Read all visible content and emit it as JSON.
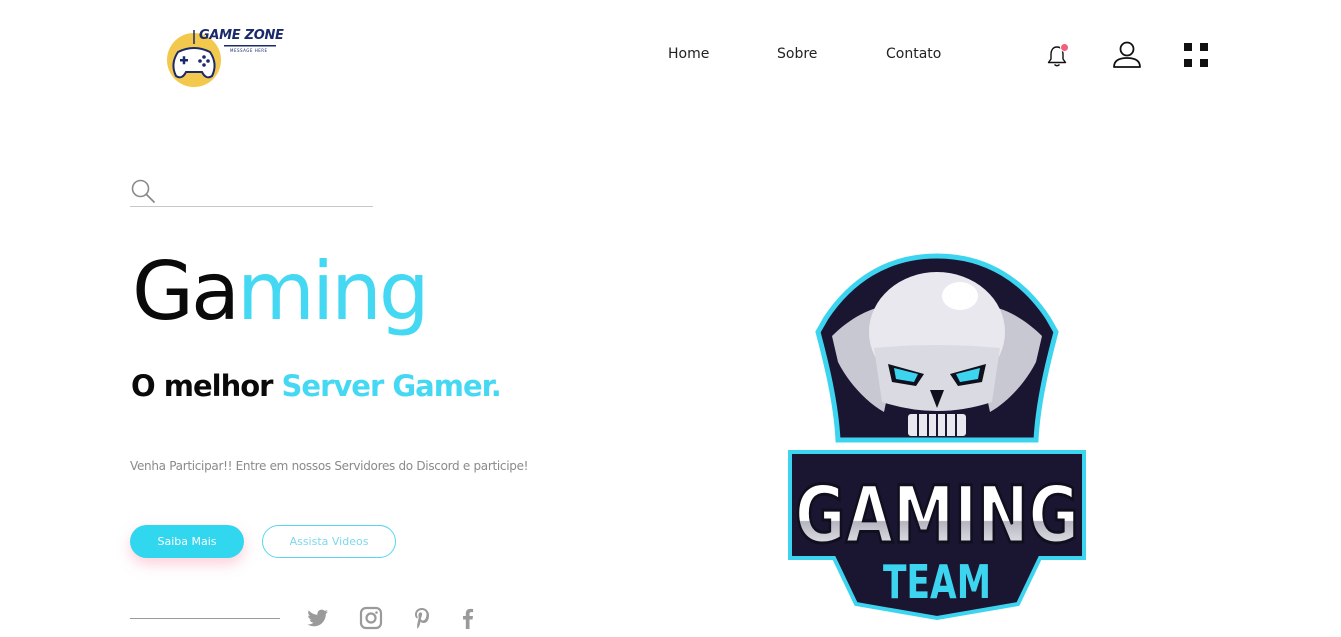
{
  "logo": {
    "brand": "GAME ZONE",
    "tagline": "MESSAGE HERE"
  },
  "nav": {
    "items": [
      {
        "label": "Home"
      },
      {
        "label": "Sobre"
      },
      {
        "label": "Contato"
      }
    ]
  },
  "icons": {
    "notifications": "bell-icon",
    "profile": "user-icon",
    "menu": "grid-icon"
  },
  "search": {
    "placeholder": "",
    "value": ""
  },
  "hero": {
    "title_dark": "Ga",
    "title_accent": "ming",
    "subtitle_dark": "O melhor ",
    "subtitle_accent": "Server Gamer.",
    "description": "Venha Participar!! Entre em nossos Servidores do Discord e participe!"
  },
  "buttons": {
    "primary": "Saiba Mais",
    "secondary": "Assista Videos"
  },
  "social": [
    "twitter-icon",
    "instagram-icon",
    "pinterest-icon",
    "facebook-icon"
  ],
  "emblem": {
    "line1": "GAMING",
    "line2": "TEAM"
  },
  "colors": {
    "accent": "#45d8f3",
    "button": "#31d6ef",
    "text": "#0a0a0a",
    "muted": "#8a8a8a",
    "badge": "#f0607a"
  }
}
